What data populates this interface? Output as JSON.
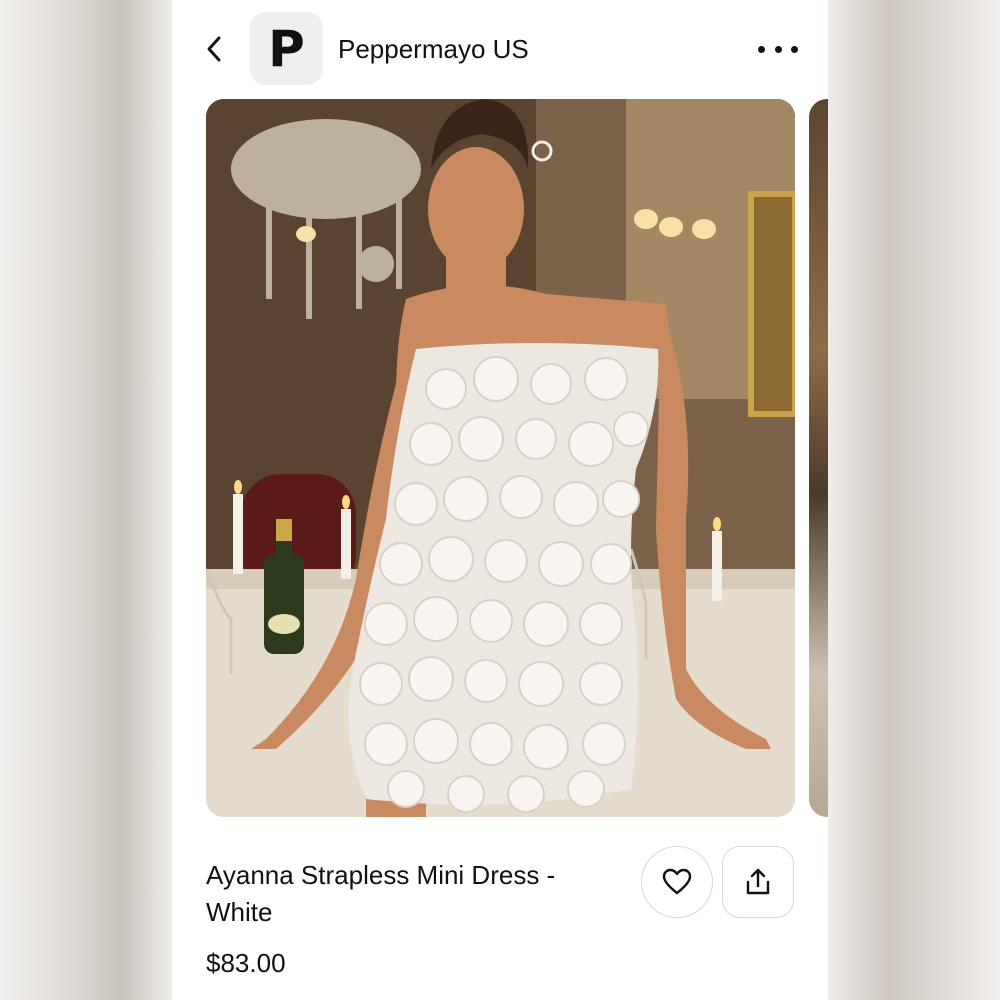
{
  "header": {
    "back_icon": "chevron-left-icon",
    "logo_letter": "P",
    "brand_name": "Peppermayo US",
    "more_icon": "more-horizontal-icon"
  },
  "product": {
    "image_alt": "Model wearing white strapless rosette mini dress at a candlelit dining table",
    "title": "Ayanna Strapless Mini Dress - White",
    "price": "$83.00"
  },
  "actions": {
    "favorite_icon": "heart-icon",
    "share_icon": "share-icon"
  },
  "colors": {
    "text": "#111111",
    "button_border": "#d8d8d8",
    "logo_bg": "#efefef"
  }
}
